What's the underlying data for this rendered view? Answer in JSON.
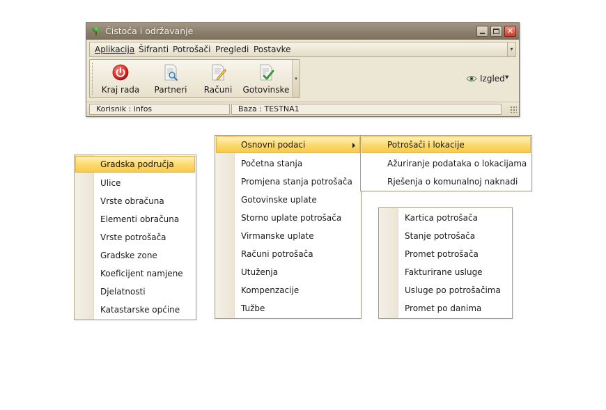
{
  "window": {
    "title": "Čistoća i održavanje"
  },
  "menu_bar": {
    "items": [
      {
        "label": "Aplikacija"
      },
      {
        "label": "Šifranti"
      },
      {
        "label": "Potrošači"
      },
      {
        "label": "Pregledi"
      },
      {
        "label": "Postavke"
      }
    ]
  },
  "toolbar": {
    "buttons": [
      {
        "label": "Kraj rada",
        "icon": "power-icon"
      },
      {
        "label": "Partneri",
        "icon": "document-search-icon"
      },
      {
        "label": "Računi",
        "icon": "document-edit-icon"
      },
      {
        "label": "Gotovinske",
        "icon": "document-check-icon"
      }
    ],
    "look_label": "Izgled"
  },
  "status_bar": {
    "user": "Korisnik  :  infos",
    "database": "Baza  :  TESTNA1"
  },
  "menus": {
    "sifranti": {
      "items": [
        {
          "label": "Gradska područja",
          "highlighted": true
        },
        {
          "label": "Ulice"
        },
        {
          "label": "Vrste obračuna"
        },
        {
          "label": "Elementi obračuna"
        },
        {
          "label": "Vrste potrošača"
        },
        {
          "label": "Gradske zone"
        },
        {
          "label": "Koeficijent namjene"
        },
        {
          "label": "Djelatnosti"
        },
        {
          "label": "Katastarske općine"
        }
      ]
    },
    "potrosaci": {
      "items": [
        {
          "label": "Osnovni podaci",
          "highlighted": true,
          "has_submenu": true
        },
        {
          "label": "Početna stanja"
        },
        {
          "label": "Promjena stanja potrošača"
        },
        {
          "label": "Gotovinske uplate"
        },
        {
          "label": "Storno uplate potrošača"
        },
        {
          "label": "Virmanske uplate"
        },
        {
          "label": "Računi potrošača"
        },
        {
          "label": "Utuženja"
        },
        {
          "label": "Kompenzacije"
        },
        {
          "label": "Tužbe"
        }
      ]
    },
    "osnovni_podaci": {
      "items": [
        {
          "label": "Potrošači i lokacije",
          "highlighted": true
        },
        {
          "label": "Ažuriranje podataka o lokacijama"
        },
        {
          "label": "Rješenja o komunalnoj naknadi"
        }
      ]
    },
    "pregledi": {
      "items": [
        {
          "label": "Kartica potrošača"
        },
        {
          "label": "Stanje potrošača"
        },
        {
          "label": "Promet potrošača"
        },
        {
          "label": "Fakturirane usluge"
        },
        {
          "label": "Usluge po potrošačima"
        },
        {
          "label": "Promet po danima"
        }
      ]
    }
  }
}
